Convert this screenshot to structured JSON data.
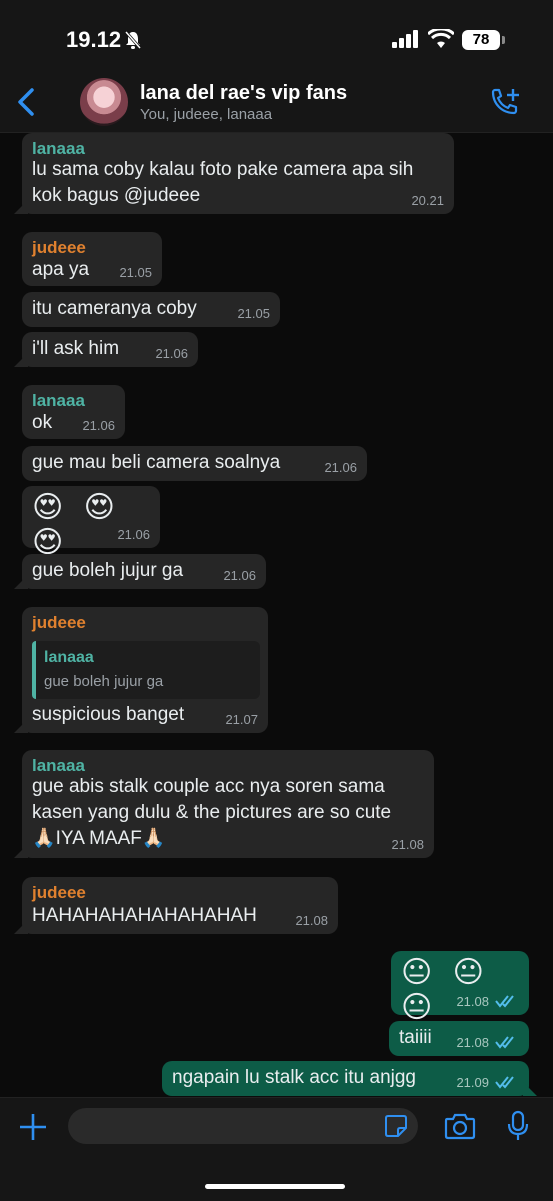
{
  "status": {
    "time": "19.12",
    "battery": "78"
  },
  "header": {
    "title": "lana del rae's vip fans",
    "subtitle": "You, judeee, lanaaa"
  },
  "messages": [
    {
      "sender": "lanaaa",
      "text": "lu sama coby kalau foto pake camera apa sih\nkok bagus @judeee",
      "time": "20.21"
    },
    {
      "sender": "judeee",
      "text": "apa ya",
      "time": "21.05"
    },
    {
      "text": "itu cameranya coby",
      "time": "21.05"
    },
    {
      "text": "i'll ask him",
      "time": "21.06"
    },
    {
      "sender": "lanaaa",
      "text": "ok",
      "time": "21.06"
    },
    {
      "text": "gue mau beli camera soalnya",
      "time": "21.06"
    },
    {
      "emoji": "😍 😍 😍",
      "time": "21.06"
    },
    {
      "text": "gue boleh jujur ga",
      "time": "21.06"
    },
    {
      "sender": "judeee",
      "quote_author": "lanaaa",
      "quote_text": "gue boleh jujur ga",
      "text": "suspicious banget",
      "time": "21.07"
    },
    {
      "sender": "lanaaa",
      "text": "gue abis stalk couple acc nya soren sama\nkasen yang dulu & the pictures are so cute\n🙏🏻IYA MAAF🙏🏻",
      "time": "21.08"
    },
    {
      "sender": "judeee",
      "text": "HAHAHAHAHAHAHAHAH",
      "time": "21.08"
    },
    {
      "emoji": "😐 😐 😐",
      "time": "21.08"
    },
    {
      "text": "taiiii",
      "time": "21.08"
    },
    {
      "text": "ngapain lu stalk acc itu anjgg",
      "time": "21.09"
    }
  ],
  "colors": {
    "incoming": "#262626",
    "outgoing": "#0d5c47",
    "lanaaa": "#4fb3a4",
    "judeee": "#e0812f",
    "accent": "#2f8ff0"
  },
  "icons": [
    "back-chevron-icon",
    "add-call-icon",
    "plus-icon",
    "sticker-icon",
    "camera-icon",
    "mic-icon",
    "bell-off-icon",
    "read-ticks-icon"
  ]
}
